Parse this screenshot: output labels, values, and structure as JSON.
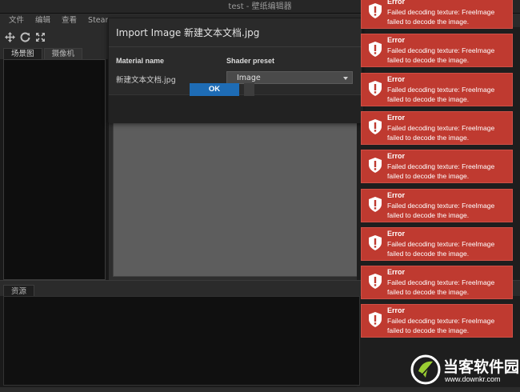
{
  "window": {
    "title": "test - 壁纸编辑器"
  },
  "menu": {
    "items": [
      "文件",
      "编辑",
      "查看",
      "Steam"
    ]
  },
  "toolbar": {
    "icons": [
      "move-icon",
      "refresh-icon",
      "fit-icon"
    ]
  },
  "left_tabs": [
    "场景图",
    "摄像机"
  ],
  "bottom_tabs": [
    "资源"
  ],
  "dialog": {
    "title": "Import Image 新建文本文档.jpg",
    "material_label": "Material name",
    "shader_label": "Shader preset",
    "file_name": "新建文本文档.jpg",
    "shader_value": "Image",
    "ok_label": "OK"
  },
  "toasts": [
    {
      "title": "Error",
      "message": "Failed decoding texture: FreeImage failed to decode the image."
    },
    {
      "title": "Error",
      "message": "Failed decoding texture: FreeImage failed to decode the image."
    },
    {
      "title": "Error",
      "message": "Failed decoding texture: FreeImage failed to decode the image."
    },
    {
      "title": "Error",
      "message": "Failed decoding texture: FreeImage failed to decode the image."
    },
    {
      "title": "Error",
      "message": "Failed decoding texture: FreeImage failed to decode the image."
    },
    {
      "title": "Error",
      "message": "Failed decoding texture: FreeImage failed to decode the image."
    },
    {
      "title": "Error",
      "message": "Failed decoding texture: FreeImage failed to decode the image."
    },
    {
      "title": "Error",
      "message": "Failed decoding texture: FreeImage failed to decode the image."
    },
    {
      "title": "Error",
      "message": "Failed decoding texture: FreeImage failed to decode the image."
    }
  ],
  "watermark": {
    "name": "当客软件园",
    "url": "www.downkr.com"
  },
  "colors": {
    "toast": "#bf3a30",
    "ok_button": "#1e6cb5",
    "background": "#1a1a1a"
  }
}
